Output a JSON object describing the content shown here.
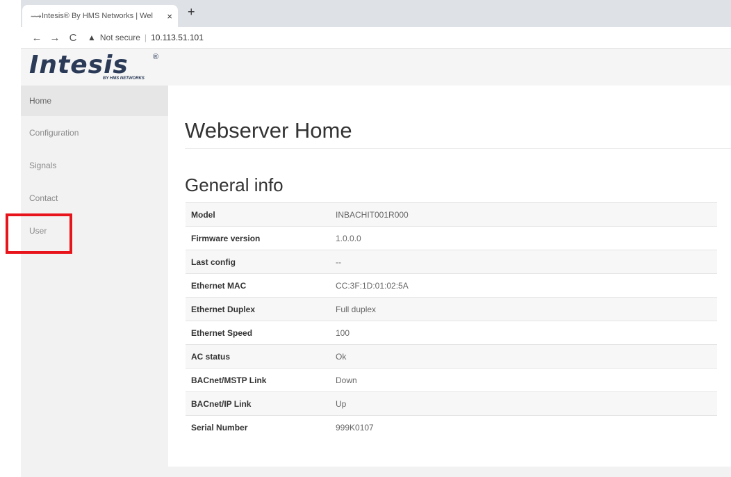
{
  "browser": {
    "tab_title": "Intesis® By HMS Networks | Wel",
    "tab_close": "×",
    "new_tab": "+",
    "back": "←",
    "forward": "→",
    "reload": "C",
    "not_secure": "Not secure",
    "address_separator": "|",
    "url": "10.113.51.101"
  },
  "header": {
    "logo_text": "Intesis",
    "logo_registered": "®",
    "logo_subtitle": "BY HMS NETWORKS"
  },
  "sidebar": {
    "items": [
      {
        "label": "Home"
      },
      {
        "label": "Configuration"
      },
      {
        "label": "Signals"
      },
      {
        "label": "Contact"
      },
      {
        "label": "User"
      }
    ]
  },
  "main": {
    "title": "Webserver Home",
    "section_title": "General info",
    "rows": [
      {
        "key": "Model",
        "value": "INBACHIT001R000"
      },
      {
        "key": "Firmware version",
        "value": "1.0.0.0"
      },
      {
        "key": "Last config",
        "value": "--"
      },
      {
        "key": "Ethernet MAC",
        "value": "CC:3F:1D:01:02:5A"
      },
      {
        "key": "Ethernet Duplex",
        "value": "Full duplex"
      },
      {
        "key": "Ethernet Speed",
        "value": "100"
      },
      {
        "key": "AC status",
        "value": "Ok"
      },
      {
        "key": "BACnet/MSTP Link",
        "value": "Down"
      },
      {
        "key": "BACnet/IP Link",
        "value": "Up"
      },
      {
        "key": "Serial Number",
        "value": "999K0107"
      }
    ]
  },
  "colors": {
    "highlight": "#e8141b",
    "logo": "#2a3a57",
    "sidebar_bg": "#f2f2f2"
  },
  "icons": {
    "favicon": "intesis-favicon-icon",
    "warning": "warning-triangle-icon"
  }
}
